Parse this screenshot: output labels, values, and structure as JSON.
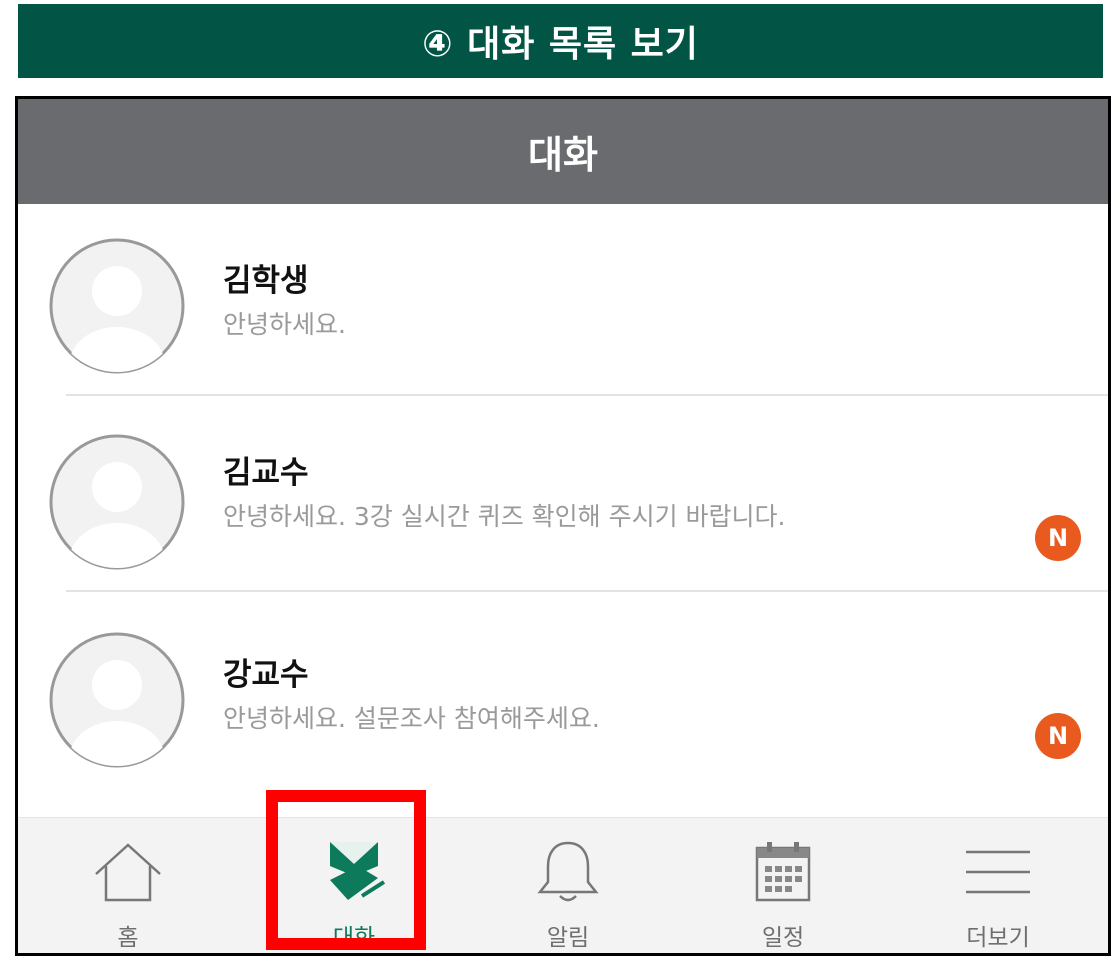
{
  "banner": {
    "title": "④ 대화 목록 보기"
  },
  "header": {
    "title": "대화"
  },
  "conversations": [
    {
      "name": "김학생",
      "message": "안녕하세요.",
      "badge": ""
    },
    {
      "name": "김교수",
      "message": "안녕하세요. 3강 실시간 퀴즈 확인해 주시기 바랍니다.",
      "badge": "N"
    },
    {
      "name": "강교수",
      "message": "안녕하세요. 설문조사 참여해주세요.",
      "badge": "N"
    }
  ],
  "tabs": [
    {
      "label": "홈",
      "icon": "home-icon"
    },
    {
      "label": "대화",
      "icon": "chat-icon",
      "active": true
    },
    {
      "label": "알림",
      "icon": "bell-icon"
    },
    {
      "label": "일정",
      "icon": "calendar-icon"
    },
    {
      "label": "더보기",
      "icon": "menu-icon"
    }
  ],
  "colors": {
    "banner": "#025545",
    "appbar": "#6a6b6f",
    "badge": "#e85a1e",
    "active_tab": "#0e7a5c",
    "highlight": "#ff0000"
  }
}
